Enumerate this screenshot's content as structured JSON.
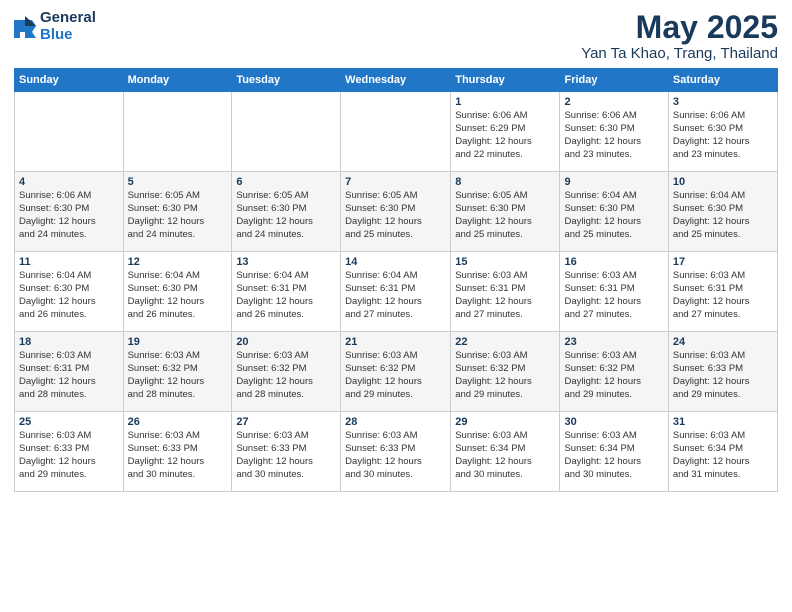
{
  "header": {
    "logo_general": "General",
    "logo_blue": "Blue",
    "title": "May 2025",
    "subtitle": "Yan Ta Khao, Trang, Thailand"
  },
  "weekdays": [
    "Sunday",
    "Monday",
    "Tuesday",
    "Wednesday",
    "Thursday",
    "Friday",
    "Saturday"
  ],
  "weeks": [
    [
      {
        "day": "",
        "info": ""
      },
      {
        "day": "",
        "info": ""
      },
      {
        "day": "",
        "info": ""
      },
      {
        "day": "",
        "info": ""
      },
      {
        "day": "1",
        "info": "Sunrise: 6:06 AM\nSunset: 6:29 PM\nDaylight: 12 hours\nand 22 minutes."
      },
      {
        "day": "2",
        "info": "Sunrise: 6:06 AM\nSunset: 6:30 PM\nDaylight: 12 hours\nand 23 minutes."
      },
      {
        "day": "3",
        "info": "Sunrise: 6:06 AM\nSunset: 6:30 PM\nDaylight: 12 hours\nand 23 minutes."
      }
    ],
    [
      {
        "day": "4",
        "info": "Sunrise: 6:06 AM\nSunset: 6:30 PM\nDaylight: 12 hours\nand 24 minutes."
      },
      {
        "day": "5",
        "info": "Sunrise: 6:05 AM\nSunset: 6:30 PM\nDaylight: 12 hours\nand 24 minutes."
      },
      {
        "day": "6",
        "info": "Sunrise: 6:05 AM\nSunset: 6:30 PM\nDaylight: 12 hours\nand 24 minutes."
      },
      {
        "day": "7",
        "info": "Sunrise: 6:05 AM\nSunset: 6:30 PM\nDaylight: 12 hours\nand 25 minutes."
      },
      {
        "day": "8",
        "info": "Sunrise: 6:05 AM\nSunset: 6:30 PM\nDaylight: 12 hours\nand 25 minutes."
      },
      {
        "day": "9",
        "info": "Sunrise: 6:04 AM\nSunset: 6:30 PM\nDaylight: 12 hours\nand 25 minutes."
      },
      {
        "day": "10",
        "info": "Sunrise: 6:04 AM\nSunset: 6:30 PM\nDaylight: 12 hours\nand 25 minutes."
      }
    ],
    [
      {
        "day": "11",
        "info": "Sunrise: 6:04 AM\nSunset: 6:30 PM\nDaylight: 12 hours\nand 26 minutes."
      },
      {
        "day": "12",
        "info": "Sunrise: 6:04 AM\nSunset: 6:30 PM\nDaylight: 12 hours\nand 26 minutes."
      },
      {
        "day": "13",
        "info": "Sunrise: 6:04 AM\nSunset: 6:31 PM\nDaylight: 12 hours\nand 26 minutes."
      },
      {
        "day": "14",
        "info": "Sunrise: 6:04 AM\nSunset: 6:31 PM\nDaylight: 12 hours\nand 27 minutes."
      },
      {
        "day": "15",
        "info": "Sunrise: 6:03 AM\nSunset: 6:31 PM\nDaylight: 12 hours\nand 27 minutes."
      },
      {
        "day": "16",
        "info": "Sunrise: 6:03 AM\nSunset: 6:31 PM\nDaylight: 12 hours\nand 27 minutes."
      },
      {
        "day": "17",
        "info": "Sunrise: 6:03 AM\nSunset: 6:31 PM\nDaylight: 12 hours\nand 27 minutes."
      }
    ],
    [
      {
        "day": "18",
        "info": "Sunrise: 6:03 AM\nSunset: 6:31 PM\nDaylight: 12 hours\nand 28 minutes."
      },
      {
        "day": "19",
        "info": "Sunrise: 6:03 AM\nSunset: 6:32 PM\nDaylight: 12 hours\nand 28 minutes."
      },
      {
        "day": "20",
        "info": "Sunrise: 6:03 AM\nSunset: 6:32 PM\nDaylight: 12 hours\nand 28 minutes."
      },
      {
        "day": "21",
        "info": "Sunrise: 6:03 AM\nSunset: 6:32 PM\nDaylight: 12 hours\nand 29 minutes."
      },
      {
        "day": "22",
        "info": "Sunrise: 6:03 AM\nSunset: 6:32 PM\nDaylight: 12 hours\nand 29 minutes."
      },
      {
        "day": "23",
        "info": "Sunrise: 6:03 AM\nSunset: 6:32 PM\nDaylight: 12 hours\nand 29 minutes."
      },
      {
        "day": "24",
        "info": "Sunrise: 6:03 AM\nSunset: 6:33 PM\nDaylight: 12 hours\nand 29 minutes."
      }
    ],
    [
      {
        "day": "25",
        "info": "Sunrise: 6:03 AM\nSunset: 6:33 PM\nDaylight: 12 hours\nand 29 minutes."
      },
      {
        "day": "26",
        "info": "Sunrise: 6:03 AM\nSunset: 6:33 PM\nDaylight: 12 hours\nand 30 minutes."
      },
      {
        "day": "27",
        "info": "Sunrise: 6:03 AM\nSunset: 6:33 PM\nDaylight: 12 hours\nand 30 minutes."
      },
      {
        "day": "28",
        "info": "Sunrise: 6:03 AM\nSunset: 6:33 PM\nDaylight: 12 hours\nand 30 minutes."
      },
      {
        "day": "29",
        "info": "Sunrise: 6:03 AM\nSunset: 6:34 PM\nDaylight: 12 hours\nand 30 minutes."
      },
      {
        "day": "30",
        "info": "Sunrise: 6:03 AM\nSunset: 6:34 PM\nDaylight: 12 hours\nand 30 minutes."
      },
      {
        "day": "31",
        "info": "Sunrise: 6:03 AM\nSunset: 6:34 PM\nDaylight: 12 hours\nand 31 minutes."
      }
    ]
  ]
}
